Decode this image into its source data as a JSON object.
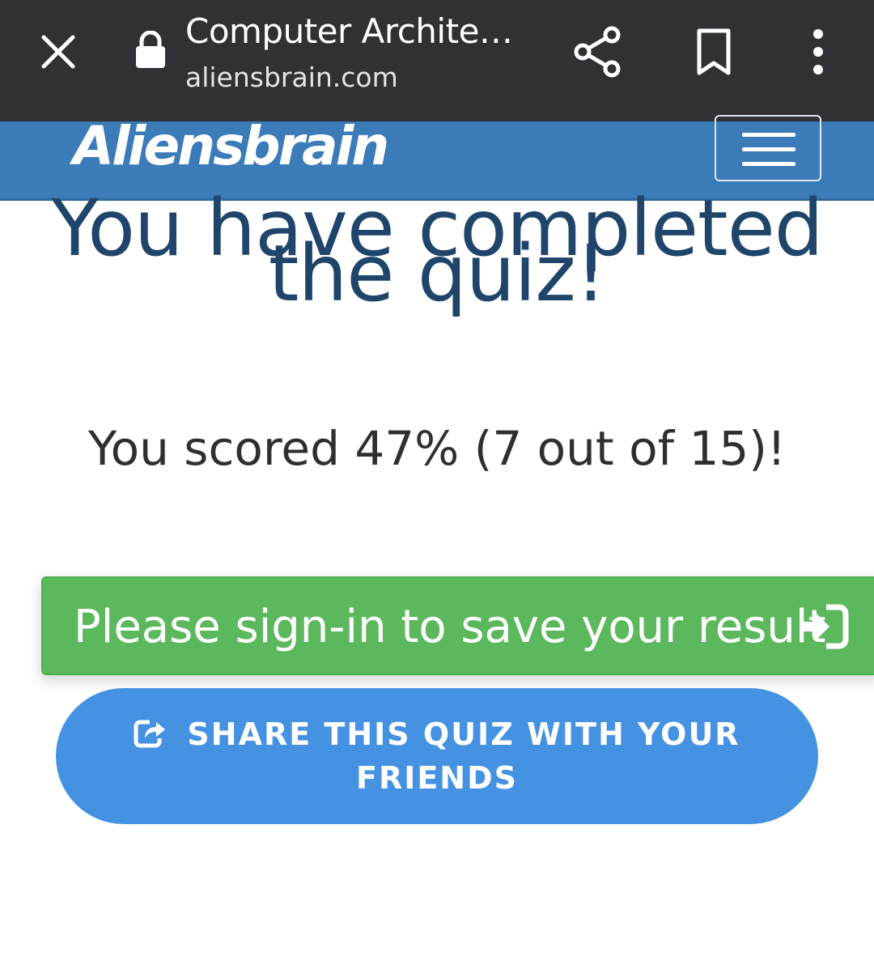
{
  "browser": {
    "page_title": "Computer Archite…",
    "url": "aliensbrain.com",
    "icons": [
      "close-icon",
      "lock-icon",
      "share-icon",
      "bookmark-icon",
      "more-vert-icon"
    ],
    "bar_color": "#303135"
  },
  "site": {
    "brand": "Aliensbrain",
    "header_color": "#3a7bb8",
    "menu_icon": "hamburger-icon"
  },
  "quiz": {
    "heading_line1": "You have completed",
    "heading_line2": "the quiz!",
    "score_text": "You scored 47% (7 out of 15)!",
    "score_percent": 47,
    "correct": 7,
    "total": 15
  },
  "actions": {
    "signin_label": "Please sign-in to save your result",
    "signin_icon": "sign-in-icon",
    "signin_color": "#5cb85c",
    "share_label_line1": "SHARE THIS QUIZ WITH YOUR",
    "share_label_line2": "FRIENDS",
    "share_icon": "share-square-icon",
    "share_color": "#4592e2"
  }
}
